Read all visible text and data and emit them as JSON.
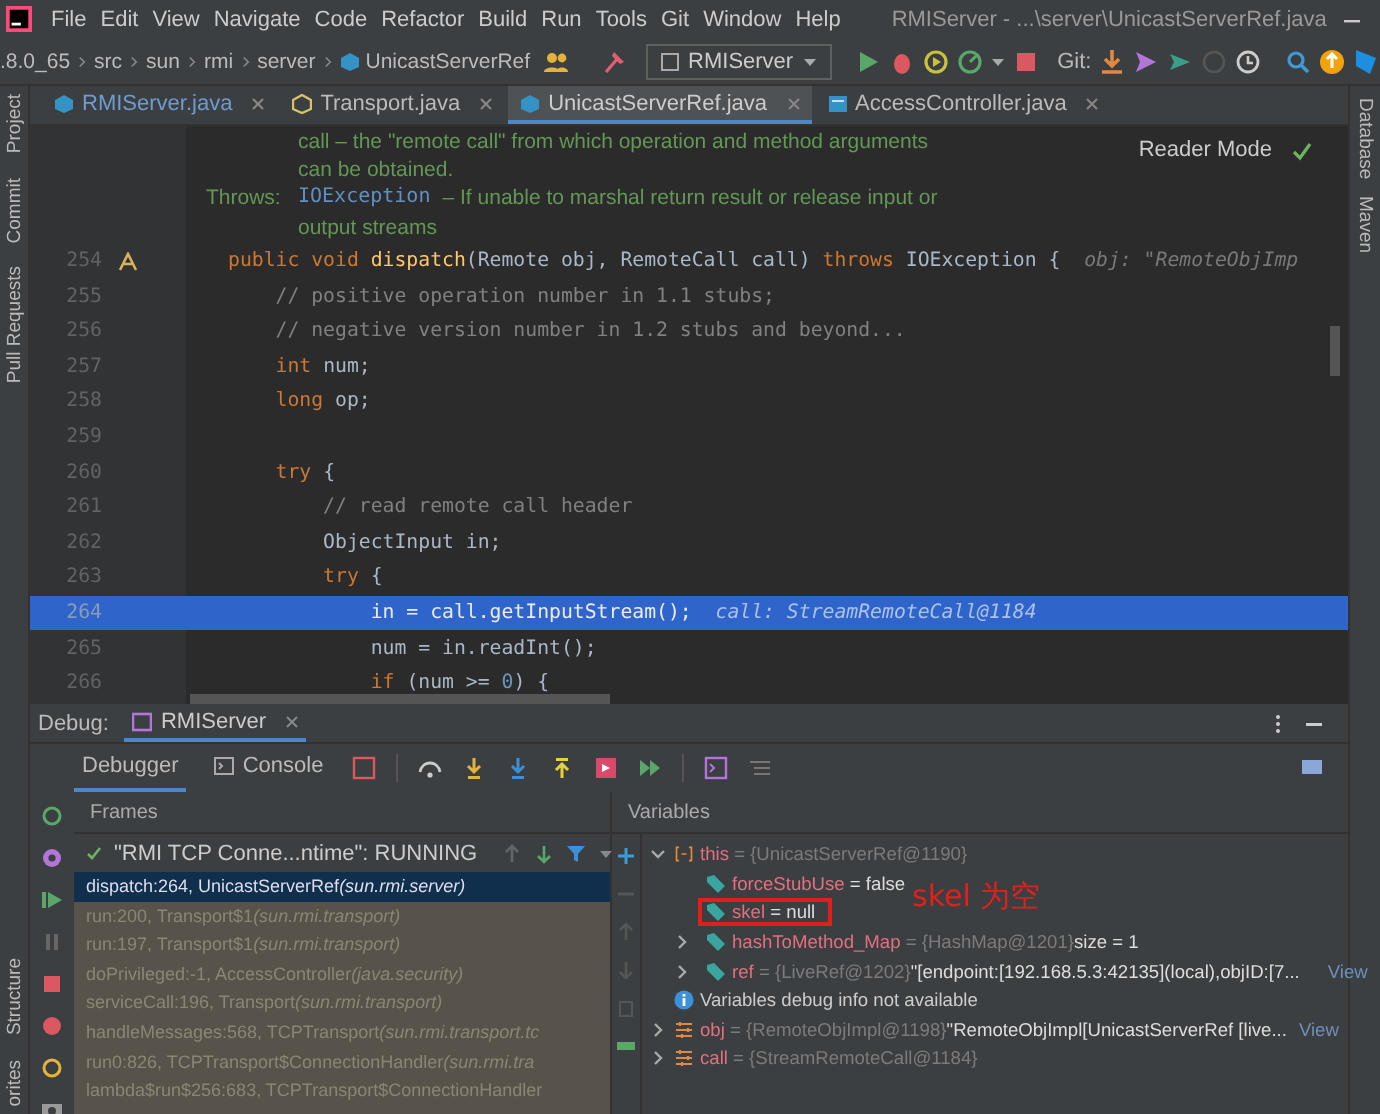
{
  "window": {
    "title": "RMIServer - ...\\server\\UnicastServerRef.java"
  },
  "menu": [
    "File",
    "Edit",
    "View",
    "Navigate",
    "Code",
    "Refactor",
    "Build",
    "Run",
    "Tools",
    "Git",
    "Window",
    "Help"
  ],
  "breadcrumb": [
    ".8.0_65",
    "src",
    "sun",
    "rmi",
    "server",
    "UnicastServerRef"
  ],
  "run_config": "RMIServer",
  "git_label": "Git:",
  "tabs": [
    {
      "label": "RMIServer.java",
      "selected": false,
      "kind": "class"
    },
    {
      "label": "Transport.java",
      "selected": false,
      "kind": "interface"
    },
    {
      "label": "UnicastServerRef.java",
      "selected": true,
      "kind": "class"
    },
    {
      "label": "AccessController.java",
      "selected": false,
      "kind": "library"
    }
  ],
  "left_tools": {
    "top": [
      "Project",
      "Commit",
      "Pull Requests"
    ],
    "bottom": [
      "Structure",
      "orites"
    ]
  },
  "right_tools": [
    "Database",
    "Maven"
  ],
  "reader_mode": "Reader Mode",
  "doc": [
    {
      "text": "call – the \"remote call\" from which operation and method arguments"
    },
    {
      "text": "can be obtained."
    },
    {
      "label": "Throws:",
      "code": "IOException",
      "text": "– If unable to marshal return result or release input or"
    },
    {
      "text": "output streams"
    }
  ],
  "code": [
    {
      "num": "254",
      "marker": true,
      "highlighted": false,
      "tokens": [
        {
          "t": "public void ",
          "kind": "kw"
        },
        {
          "t": "dispatch",
          "kind": "fn"
        },
        {
          "t": "(Remote obj, RemoteCall call) ",
          "kind": "plain"
        },
        {
          "t": "throws ",
          "kind": "kw"
        },
        {
          "t": "IOException {",
          "kind": "plain"
        }
      ],
      "hint": "obj: \"RemoteObjImp"
    },
    {
      "num": "255",
      "marker": false,
      "highlighted": false,
      "tokens": [
        {
          "t": "    // positive operation number in 1.1 stubs;",
          "kind": "comment"
        }
      ]
    },
    {
      "num": "256",
      "marker": false,
      "highlighted": false,
      "tokens": [
        {
          "t": "    // negative version number in 1.2 stubs and beyond...",
          "kind": "comment"
        }
      ]
    },
    {
      "num": "257",
      "marker": false,
      "highlighted": false,
      "tokens": [
        {
          "t": "    int ",
          "kind": "kw"
        },
        {
          "t": "num;",
          "kind": "plain"
        }
      ]
    },
    {
      "num": "258",
      "marker": false,
      "highlighted": false,
      "tokens": [
        {
          "t": "    long ",
          "kind": "kw"
        },
        {
          "t": "op;",
          "kind": "plain"
        }
      ]
    },
    {
      "num": "259",
      "marker": false,
      "highlighted": false
    },
    {
      "num": "260",
      "marker": false,
      "highlighted": false,
      "tokens": [
        {
          "t": "    try ",
          "kind": "kw"
        },
        {
          "t": "{",
          "kind": "plain"
        }
      ]
    },
    {
      "num": "261",
      "marker": false,
      "highlighted": false,
      "tokens": [
        {
          "t": "        // read remote call header",
          "kind": "comment"
        }
      ]
    },
    {
      "num": "262",
      "marker": false,
      "highlighted": false,
      "tokens": [
        {
          "t": "        ObjectInput in;",
          "kind": "plain"
        }
      ]
    },
    {
      "num": "263",
      "marker": false,
      "highlighted": false,
      "tokens": [
        {
          "t": "        try ",
          "kind": "kw"
        },
        {
          "t": "{",
          "kind": "plain"
        }
      ]
    },
    {
      "num": "264",
      "marker": false,
      "highlighted": true,
      "tokens": [
        {
          "t": "            in = call.getInputStream();",
          "kind": "plain"
        }
      ],
      "hint": "call: StreamRemoteCall@1184"
    },
    {
      "num": "265",
      "marker": false,
      "highlighted": false,
      "tokens": [
        {
          "t": "            num = in.readInt();",
          "kind": "plain"
        }
      ]
    },
    {
      "num": "266",
      "marker": false,
      "highlighted": false,
      "tokens": [
        {
          "t": "            if ",
          "kind": "kw"
        },
        {
          "t": "(num >= ",
          "kind": "plain"
        },
        {
          "t": "0",
          "kind": "num"
        },
        {
          "t": ") {",
          "kind": "plain"
        }
      ]
    }
  ],
  "debug": {
    "title": "Debug:",
    "session": "RMIServer",
    "tabs": [
      {
        "label": "Debugger",
        "selected": true,
        "kind": "debugger"
      },
      {
        "label": "Console",
        "selected": false,
        "kind": "console"
      }
    ],
    "frames_header": "Frames",
    "thread": "\"RMI TCP Conne...ntime\": RUNNING",
    "frames": [
      {
        "method": "dispatch:264, UnicastServerRef",
        "package": "(sun.rmi.server)",
        "selected": true
      },
      {
        "method": "run:200, Transport$1",
        "package": "(sun.rmi.transport)",
        "selected": false
      },
      {
        "method": "run:197, Transport$1",
        "package": "(sun.rmi.transport)",
        "selected": false
      },
      {
        "method": "doPrivileged:-1, AccessController",
        "package": "(java.security)",
        "selected": false
      },
      {
        "method": "serviceCall:196, Transport",
        "package": "(sun.rmi.transport)",
        "selected": false
      },
      {
        "method": "handleMessages:568, TCPTransport",
        "package": "(sun.rmi.transport.tc",
        "selected": false
      },
      {
        "method": "run0:826, TCPTransport$ConnectionHandler",
        "package": "(sun.rmi.tra",
        "selected": false
      },
      {
        "method": "lambda$run$256:683, TCPTransport$ConnectionHandler",
        "selected": false
      }
    ],
    "variables_header": "Variables",
    "variables": [
      {
        "kind": "object",
        "name": "this",
        "value": "= {UnicastServerRef@1190}",
        "expanded": true,
        "children": [
          {
            "kind": "field",
            "name": "forceStubUse",
            "value": "= false"
          },
          {
            "kind": "field",
            "name": "skel",
            "value": "= null",
            "annotated": true
          },
          {
            "kind": "field",
            "name": "hashToMethod_Map",
            "value": "= {HashMap@1201}",
            "extra": "size = 1",
            "expanded": false
          },
          {
            "kind": "field",
            "name": "ref",
            "value": "= {LiveRef@1202}",
            "extra": "\"[endpoint:[192.168.5.3:42135](local),objID:[7...",
            "link": "View",
            "expanded": false
          }
        ]
      },
      {
        "kind": "info",
        "text": "Variables debug info not available"
      },
      {
        "kind": "param",
        "name": "obj",
        "value": "= {RemoteObjImpl@1198}",
        "extra": "\"RemoteObjImpl[UnicastServerRef [live...",
        "link": "View",
        "expanded": false
      },
      {
        "kind": "param",
        "name": "call",
        "value": "= {StreamRemoteCall@1184}",
        "expanded": false
      }
    ],
    "annotation": "skel 为空"
  }
}
